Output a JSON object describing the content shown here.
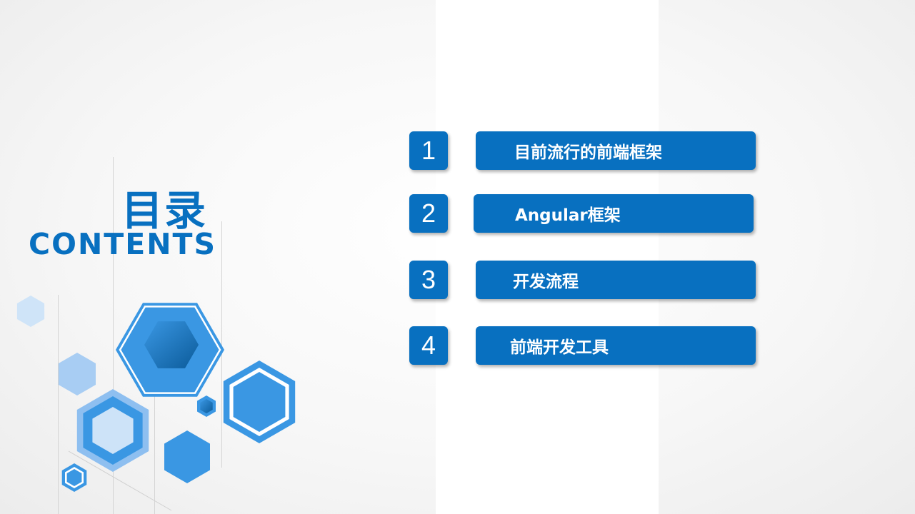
{
  "title": "目录",
  "subtitle": "CONTENTS",
  "accent_color": "#0870c0",
  "items": [
    {
      "number": "1",
      "label": "目前流行的前端框架"
    },
    {
      "number": "2",
      "label": "Angular框架"
    },
    {
      "number": "3",
      "label": "开发流程"
    },
    {
      "number": "4",
      "label": "前端开发工具"
    }
  ]
}
